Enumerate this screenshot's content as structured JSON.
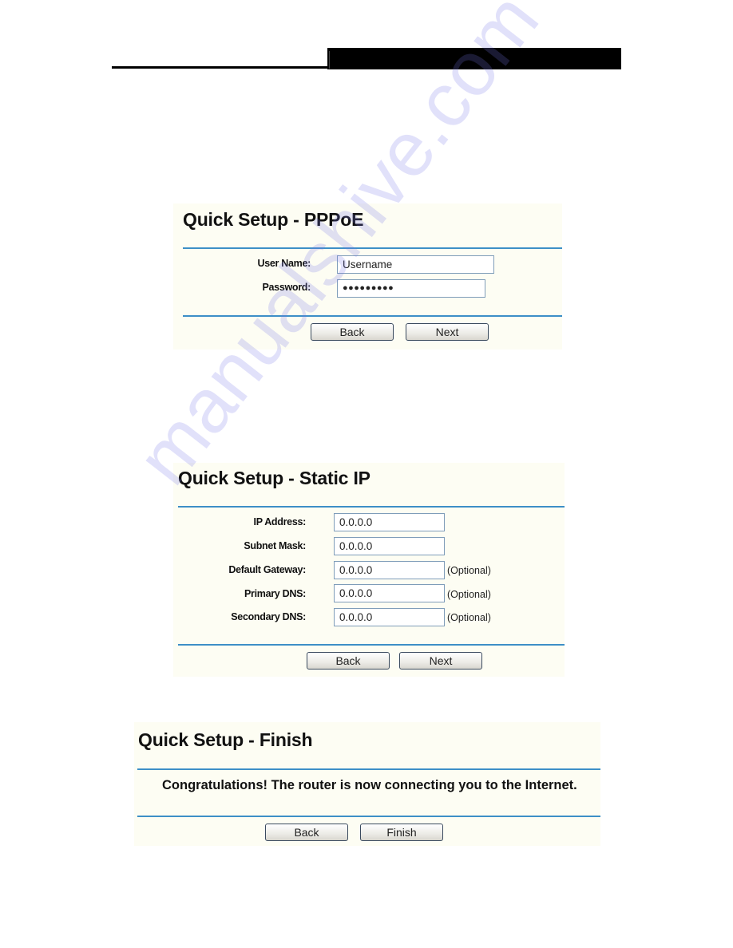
{
  "pppoe": {
    "title": "Quick Setup - PPPoE",
    "username_label": "User Name:",
    "username_value": "Username",
    "password_label": "Password:",
    "password_value": "●●●●●●●●●",
    "back_label": "Back",
    "next_label": "Next"
  },
  "static_ip": {
    "title": "Quick Setup - Static IP",
    "fields": [
      {
        "label": "IP Address:",
        "value": "0.0.0.0",
        "note": ""
      },
      {
        "label": "Subnet Mask:",
        "value": "0.0.0.0",
        "note": ""
      },
      {
        "label": "Default Gateway:",
        "value": "0.0.0.0",
        "note": "(Optional)"
      },
      {
        "label": "Primary DNS:",
        "value": "0.0.0.0",
        "note": "(Optional)"
      },
      {
        "label": "Secondary DNS:",
        "value": "0.0.0.0",
        "note": "(Optional)"
      }
    ],
    "back_label": "Back",
    "next_label": "Next"
  },
  "finish": {
    "title": "Quick Setup - Finish",
    "message": "Congratulations! The router is now connecting you to the Internet.",
    "back_label": "Back",
    "finish_label": "Finish"
  },
  "watermark": "manualshive.com",
  "colors": {
    "rule": "#3d8fc7",
    "panel_bg": "#fdfdf3"
  }
}
